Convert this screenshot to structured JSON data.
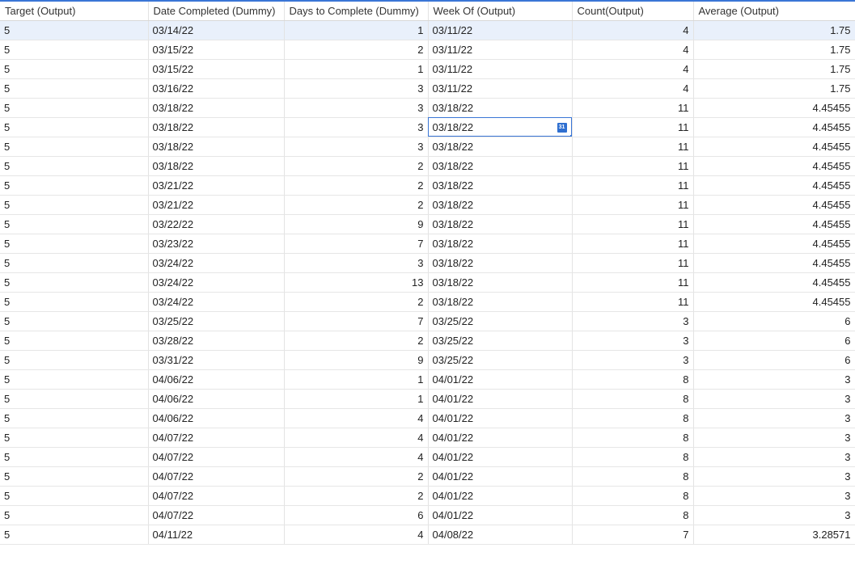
{
  "columns": [
    "Target (Output)",
    "Date Completed (Dummy)",
    "Days to Complete (Dummy)",
    "Week Of (Output)",
    "Count(Output)",
    "Average (Output)"
  ],
  "rows": [
    [
      "5",
      "03/14/22",
      "1",
      "03/11/22",
      "4",
      "1.75"
    ],
    [
      "5",
      "03/15/22",
      "2",
      "03/11/22",
      "4",
      "1.75"
    ],
    [
      "5",
      "03/15/22",
      "1",
      "03/11/22",
      "4",
      "1.75"
    ],
    [
      "5",
      "03/16/22",
      "3",
      "03/11/22",
      "4",
      "1.75"
    ],
    [
      "5",
      "03/18/22",
      "3",
      "03/18/22",
      "11",
      "4.45455"
    ],
    [
      "5",
      "03/18/22",
      "3",
      "03/18/22",
      "11",
      "4.45455"
    ],
    [
      "5",
      "03/18/22",
      "3",
      "03/18/22",
      "11",
      "4.45455"
    ],
    [
      "5",
      "03/18/22",
      "2",
      "03/18/22",
      "11",
      "4.45455"
    ],
    [
      "5",
      "03/21/22",
      "2",
      "03/18/22",
      "11",
      "4.45455"
    ],
    [
      "5",
      "03/21/22",
      "2",
      "03/18/22",
      "11",
      "4.45455"
    ],
    [
      "5",
      "03/22/22",
      "9",
      "03/18/22",
      "11",
      "4.45455"
    ],
    [
      "5",
      "03/23/22",
      "7",
      "03/18/22",
      "11",
      "4.45455"
    ],
    [
      "5",
      "03/24/22",
      "3",
      "03/18/22",
      "11",
      "4.45455"
    ],
    [
      "5",
      "03/24/22",
      "13",
      "03/18/22",
      "11",
      "4.45455"
    ],
    [
      "5",
      "03/24/22",
      "2",
      "03/18/22",
      "11",
      "4.45455"
    ],
    [
      "5",
      "03/25/22",
      "7",
      "03/25/22",
      "3",
      "6"
    ],
    [
      "5",
      "03/28/22",
      "2",
      "03/25/22",
      "3",
      "6"
    ],
    [
      "5",
      "03/31/22",
      "9",
      "03/25/22",
      "3",
      "6"
    ],
    [
      "5",
      "04/06/22",
      "1",
      "04/01/22",
      "8",
      "3"
    ],
    [
      "5",
      "04/06/22",
      "1",
      "04/01/22",
      "8",
      "3"
    ],
    [
      "5",
      "04/06/22",
      "4",
      "04/01/22",
      "8",
      "3"
    ],
    [
      "5",
      "04/07/22",
      "4",
      "04/01/22",
      "8",
      "3"
    ],
    [
      "5",
      "04/07/22",
      "4",
      "04/01/22",
      "8",
      "3"
    ],
    [
      "5",
      "04/07/22",
      "2",
      "04/01/22",
      "8",
      "3"
    ],
    [
      "5",
      "04/07/22",
      "2",
      "04/01/22",
      "8",
      "3"
    ],
    [
      "5",
      "04/07/22",
      "6",
      "04/01/22",
      "8",
      "3"
    ],
    [
      "5",
      "04/11/22",
      "4",
      "04/08/22",
      "7",
      "3.28571"
    ]
  ],
  "selected_row": 0,
  "active_cell": {
    "row": 5,
    "col": 3
  },
  "active_cell_icon": "calendar-icon",
  "calendar_icon_text": "31",
  "accent_color": "#3a76d6"
}
